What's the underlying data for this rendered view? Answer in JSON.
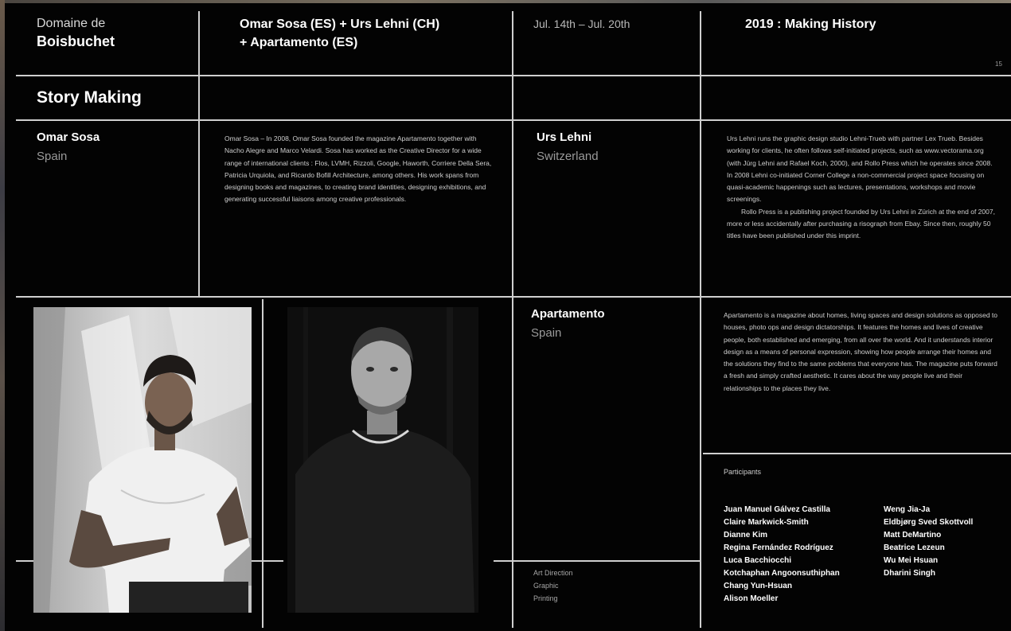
{
  "header": {
    "venue_line1": "Domaine de",
    "venue_line2": "Boisbuchet",
    "participants_line1": "Omar Sosa (ES) + Urs Lehni (CH)",
    "participants_line2": "+ Apartamento (ES)",
    "dates": "Jul. 14th – Jul. 20th",
    "series": "2019 : Making History",
    "page_number": "15"
  },
  "section_title": "Story Making",
  "people": [
    {
      "name": "Omar Sosa",
      "country": "Spain",
      "bio": "Omar Sosa – In 2008, Omar Sosa founded the magazine Apartamento together with Nacho Alegre and Marco Velardi. Sosa has worked as the Creative Director for a wide range of international clients : Flos, LVMH, Rizzoli, Google, Haworth, Corriere Della Sera, Patricia Urquiola, and Ricardo Bofill Architecture, among others. His work spans from designing books and magazines, to creating brand identities, designing exhibitions, and generating successful liaisons among creative professionals."
    },
    {
      "name": "Urs Lehni",
      "country": "Switzerland",
      "bio": "Urs Lehni runs the graphic design studio Lehni-Trueb with partner Lex Trueb. Besides working for clients, he often follows self-initiated projects, such as www.vectorama.org (with Jürg Lehni and Rafael Koch, 2000), and Rollo Press which he operates since 2008. In 2008 Lehni co-initiated Corner College a non-commercial project space focusing on quasi-academic happenings such as lectures, presentations, workshops and movie screenings.",
      "bio2": "Rollo Press is a publishing project founded by Urs Lehni in Zürich at the end of 2007, more or less accidentally after purchasing a risograph from Ebay. Since then, roughly 50 titles have been published under this imprint."
    },
    {
      "name": "Apartamento",
      "country": "Spain",
      "bio": "Apartamento is a magazine about homes, living spaces and design solutions as opposed to houses, photo ops and design dictatorships. It features the homes and lives of creative people, both established and emerging, from all over the world. And it understands interior design as a means of personal expression, showing how people arrange their homes and the solutions they find to the same problems that everyone has. The magazine puts forward a fresh and simply crafted aesthetic. It cares about the way people live and their relationships to the places they live."
    }
  ],
  "categories": [
    "Art Direction",
    "Graphic",
    "Printing"
  ],
  "participants": {
    "label": "Participants",
    "column1": [
      "Juan Manuel Gálvez Castilla",
      "Claire Markwick-Smith",
      "Dianne Kim",
      "Regina Fernández Rodríguez",
      "Luca Bacchiocchi",
      "Kotchaphan Angoonsuthiphan",
      "Chang Yun-Hsuan",
      "Alison Moeller"
    ],
    "column2": [
      "Weng Jia-Ja",
      "Eldbjørg Sved Skottvoll",
      "Matt DeMartino",
      "Beatrice Lezeun",
      "Wu Mei Hsuan",
      "Dharini Singh"
    ]
  },
  "colors": {
    "background": "#030303",
    "rules": "#cfcfcf",
    "text": "#ffffff",
    "muted": "#9a9a9a"
  }
}
